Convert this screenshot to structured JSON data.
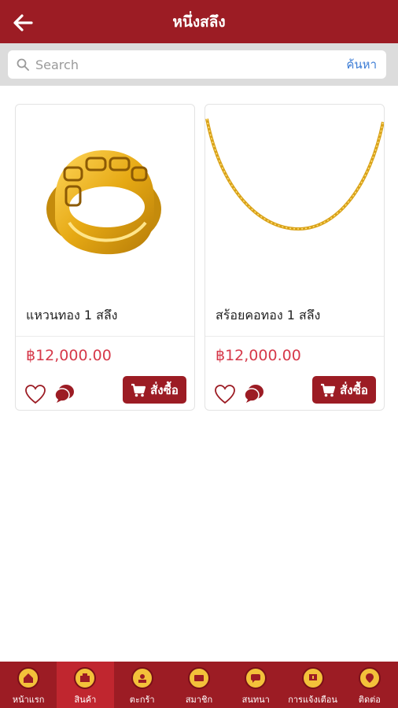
{
  "header": {
    "title": "หนึ่งสลึง"
  },
  "search": {
    "placeholder": "Search",
    "button_label": "ค้นหา"
  },
  "products": [
    {
      "name": "แหวนทอง 1 สลึง",
      "price": "฿12,000.00",
      "order_label": "สั่งซื้อ"
    },
    {
      "name": "สร้อยคอทอง 1 สลึง",
      "price": "฿12,000.00",
      "order_label": "สั่งซื้อ"
    }
  ],
  "nav": {
    "items": [
      {
        "label": "หน้าแรก",
        "icon": "home-icon"
      },
      {
        "label": "สินค้า",
        "icon": "products-icon",
        "active": true
      },
      {
        "label": "ตะกร้า",
        "icon": "cart-icon"
      },
      {
        "label": "สมาชิก",
        "icon": "member-icon"
      },
      {
        "label": "สนทนา",
        "icon": "chat-icon"
      },
      {
        "label": "การแจ้งเตือน",
        "icon": "notification-icon"
      },
      {
        "label": "ติดต่อ",
        "icon": "contact-icon"
      }
    ]
  },
  "colors": {
    "primary": "#9c1c24",
    "price": "#d6394a",
    "link": "#3a7bd5",
    "gold": "#f3c13a"
  }
}
